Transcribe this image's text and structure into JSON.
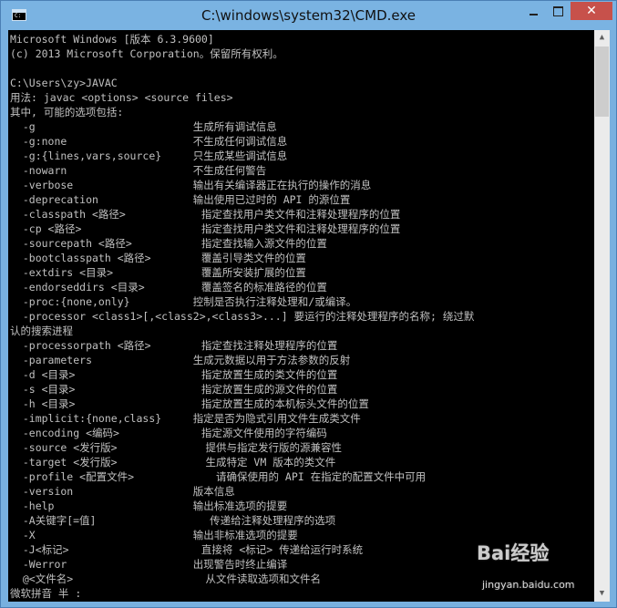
{
  "window": {
    "title": "C:\\windows\\system32\\CMD.exe",
    "icon": "cmd-icon",
    "controls": {
      "minimize": "minimize-icon",
      "maximize": "maximize-icon",
      "close": "✕"
    }
  },
  "console": {
    "lines": [
      "Microsoft Windows [版本 6.3.9600]",
      "(c) 2013 Microsoft Corporation。保留所有权利。",
      "",
      "C:\\Users\\zy>JAVAC",
      "用法: javac <options> <source files>",
      "其中, 可能的选项包括:",
      "  -g                         生成所有调试信息",
      "  -g:none                    不生成任何调试信息",
      "  -g:{lines,vars,source}     只生成某些调试信息",
      "  -nowarn                    不生成任何警告",
      "  -verbose                   输出有关编译器正在执行的操作的消息",
      "  -deprecation               输出使用已过时的 API 的源位置",
      "  -classpath <路径>            指定查找用户类文件和注释处理程序的位置",
      "  -cp <路径>                   指定查找用户类文件和注释处理程序的位置",
      "  -sourcepath <路径>           指定查找输入源文件的位置",
      "  -bootclasspath <路径>        覆盖引导类文件的位置",
      "  -extdirs <目录>              覆盖所安装扩展的位置",
      "  -endorseddirs <目录>         覆盖签名的标准路径的位置",
      "  -proc:{none,only}          控制是否执行注释处理和/或编译。",
      "  -processor <class1>[,<class2>,<class3>...] 要运行的注释处理程序的名称; 绕过默",
      "认的搜索进程",
      "  -processorpath <路径>        指定查找注释处理程序的位置",
      "  -parameters                生成元数据以用于方法参数的反射",
      "  -d <目录>                    指定放置生成的类文件的位置",
      "  -s <目录>                    指定放置生成的源文件的位置",
      "  -h <目录>                    指定放置生成的本机标头文件的位置",
      "  -implicit:{none,class}     指定是否为隐式引用文件生成类文件",
      "  -encoding <编码>             指定源文件使用的字符编码",
      "  -source <发行版>              提供与指定发行版的源兼容性",
      "  -target <发行版>              生成特定 VM 版本的类文件",
      "  -profile <配置文件>             请确保使用的 API 在指定的配置文件中可用",
      "  -version                   版本信息",
      "  -help                      输出标准选项的提要",
      "  -A关键字[=值]                  传递给注释处理程序的选项",
      "  -X                         输出非标准选项的提要",
      "  -J<标记>                     直接将 <标记> 传递给运行时系统",
      "  -Werror                    出现警告时终止编译",
      "  @<文件名>                     从文件读取选项和文件名",
      "微软拼音 半 :"
    ]
  },
  "scrollbar": {
    "up": "▲",
    "down": "▼",
    "position": 0.0
  },
  "watermark": {
    "logo": "Bai经验",
    "url": "jingyan.baidu.com"
  }
}
